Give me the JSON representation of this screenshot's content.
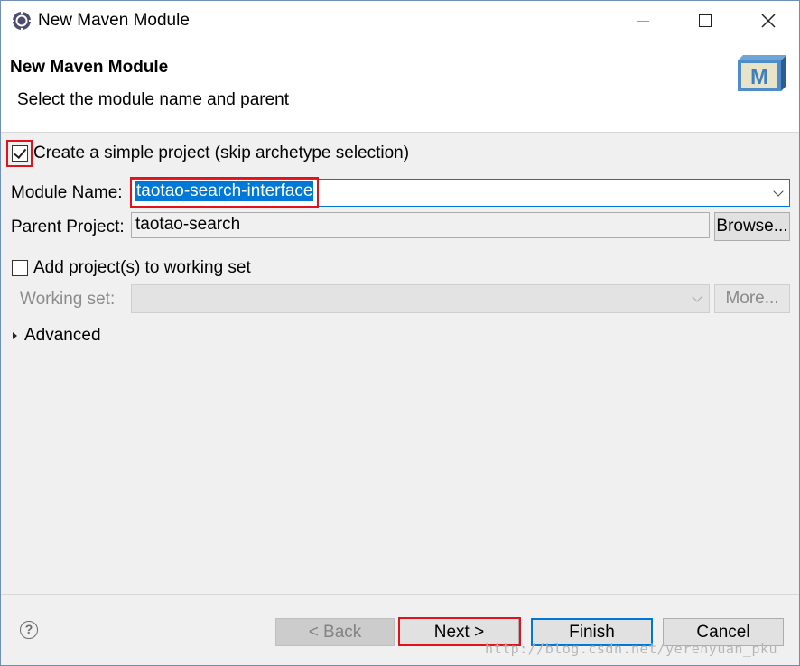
{
  "window": {
    "title": "New Maven Module"
  },
  "banner": {
    "title": "New Maven Module",
    "subtitle": "Select the module name and parent",
    "logo_letter": "M"
  },
  "form": {
    "simple_project": {
      "label": "Create a simple project (skip archetype selection)",
      "checked": true
    },
    "module_name": {
      "label": "Module Name:",
      "value": "taotao-search-interface"
    },
    "parent_project": {
      "label": "Parent Project:",
      "value": "taotao-search",
      "browse_label": "Browse..."
    },
    "working_set_toggle": {
      "label": "Add project(s) to working set",
      "checked": false
    },
    "working_set": {
      "label": "Working set:",
      "value": "",
      "more_label": "More..."
    },
    "advanced": {
      "label": "Advanced"
    }
  },
  "footer": {
    "help_glyph": "?",
    "back_label": "< Back",
    "next_label": "Next >",
    "finish_label": "Finish",
    "cancel_label": "Cancel"
  },
  "watermark": "http://blog.csdn.net/yerenyuan_pku",
  "colors": {
    "accent": "#0078d7",
    "highlight_frame": "#e0121c"
  },
  "icons": [
    "eclipse-app-icon",
    "minimize-icon",
    "maximize-icon",
    "close-icon",
    "maven-logo",
    "checkbox-checked-icon",
    "dropdown-chevron-icon",
    "expand-triangle-icon",
    "help-icon"
  ]
}
